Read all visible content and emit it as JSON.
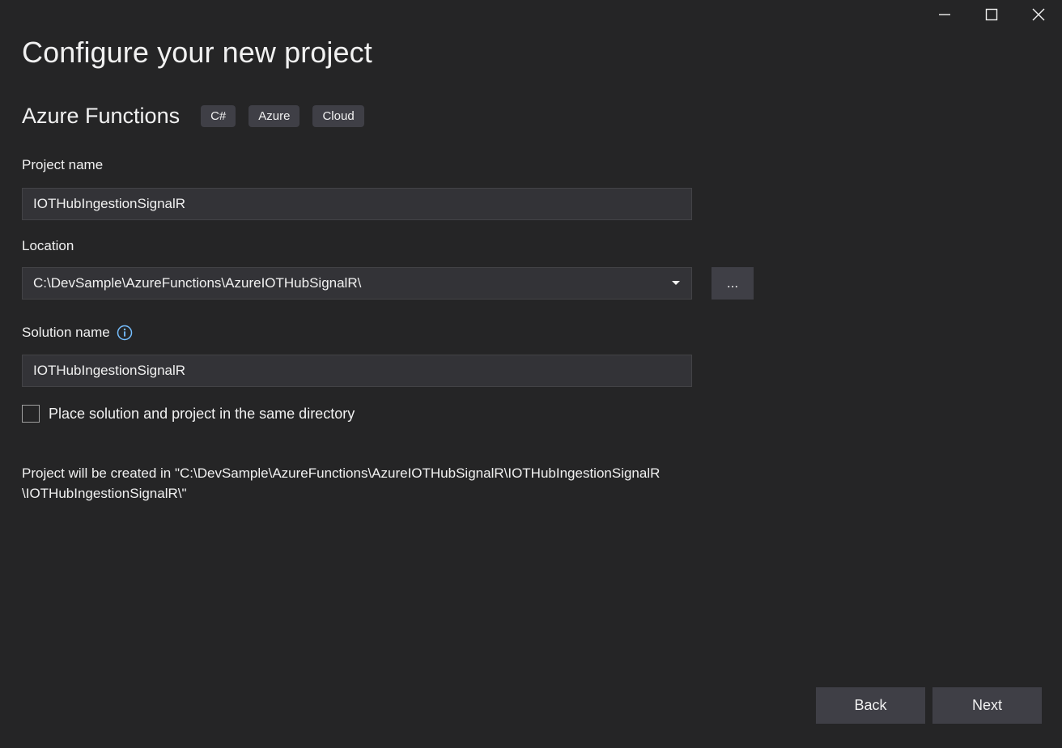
{
  "window_controls": {
    "minimize": "minimize-icon",
    "maximize": "maximize-icon",
    "close": "close-icon"
  },
  "header": {
    "title": "Configure your new project"
  },
  "template": {
    "name": "Azure Functions",
    "tags": [
      "C#",
      "Azure",
      "Cloud"
    ]
  },
  "project_name": {
    "label": "Project name",
    "value": "IOTHubIngestionSignalR"
  },
  "location": {
    "label": "Location",
    "value": "C:\\DevSample\\AzureFunctions\\AzureIOTHubSignalR\\",
    "browse_label": "..."
  },
  "solution_name": {
    "label": "Solution name",
    "value": "IOTHubIngestionSignalR",
    "info_icon": "info-icon"
  },
  "same_directory": {
    "label": "Place solution and project in the same directory",
    "checked": false
  },
  "created_path": {
    "line1": "Project will be created in \"C:\\DevSample\\AzureFunctions\\AzureIOTHubSignalR\\IOTHubIngestionSignalR",
    "line2": "\\IOTHubIngestionSignalR\\\""
  },
  "footer": {
    "back_label": "Back",
    "next_label": "Next"
  },
  "colors": {
    "background": "#252526",
    "input_background": "#333337",
    "button_background": "#3f3f46",
    "info_accent": "#75beff",
    "text": "#f1f1f1"
  }
}
